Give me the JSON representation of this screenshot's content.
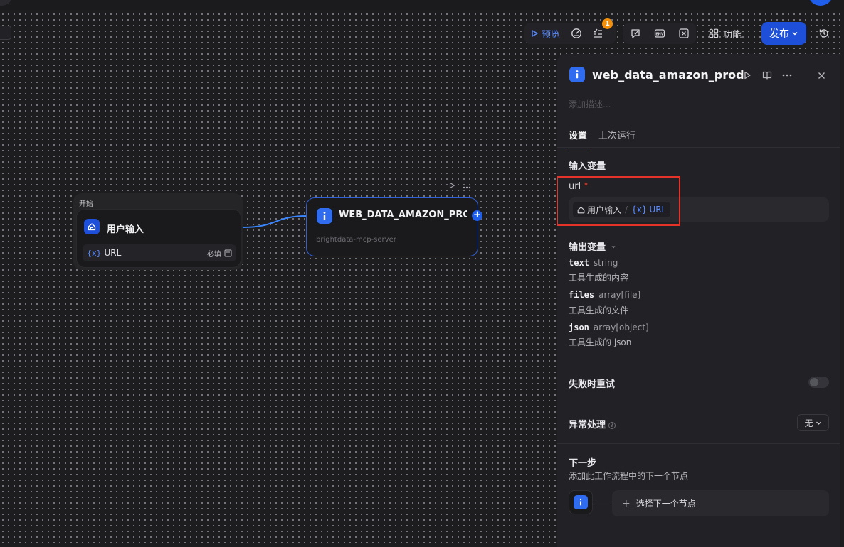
{
  "toolbar": {
    "preview_label": "预览",
    "checklist_badge": "1",
    "features_label": "功能",
    "publish_label": "发布"
  },
  "canvas": {
    "start_node": {
      "section_label": "开始",
      "title": "用户输入",
      "variable": {
        "symbol": "{x}",
        "name": "URL",
        "required_label": "必填"
      }
    },
    "tool_node": {
      "title": "WEB_DATA_AMAZON_PROI",
      "subtitle": "brightdata-mcp-server",
      "add_symbol": "+"
    }
  },
  "panel": {
    "title": "web_data_amazon_prod",
    "description_placeholder": "添加描述...",
    "tabs": [
      {
        "label": "设置",
        "active": true
      },
      {
        "label": "上次运行",
        "active": false
      }
    ],
    "input_section": {
      "title": "输入变量",
      "field_label": "url",
      "required_mark": "*",
      "value": {
        "source": "用户输入",
        "separator": "/",
        "symbol": "{x}",
        "var": "URL"
      }
    },
    "output_section": {
      "title": "输出变量",
      "items": [
        {
          "name": "text",
          "type": "string",
          "desc": "工具生成的内容"
        },
        {
          "name": "files",
          "type": "array[file]",
          "desc": "工具生成的文件"
        },
        {
          "name": "json",
          "type": "array[object]",
          "desc": "工具生成的 json"
        }
      ]
    },
    "retry": {
      "title": "失败时重试",
      "enabled": false
    },
    "error_handling": {
      "title": "异常处理",
      "value": "无"
    },
    "next_step": {
      "title": "下一步",
      "subtitle": "添加此工作流程中的下一个节点",
      "select_label": "选择下一个节点"
    }
  },
  "colors": {
    "accent": "#1d4fd8",
    "highlight": "#e5332a",
    "background": "#1d1d20"
  }
}
